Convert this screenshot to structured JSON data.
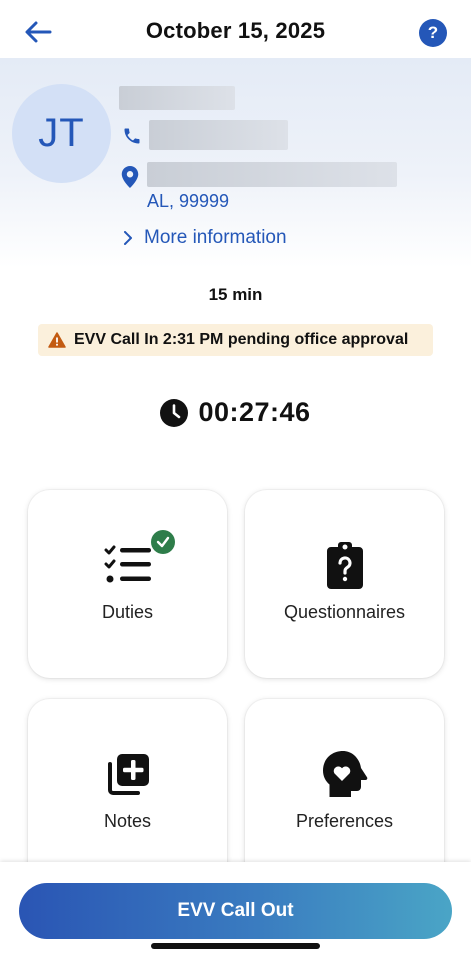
{
  "header": {
    "title": "October 15, 2025",
    "help_label": "?"
  },
  "client": {
    "initials": "JT",
    "address_line": "AL, 99999",
    "more_info_label": "More information"
  },
  "visit": {
    "duration": "15 min",
    "status_banner": "EVV Call In 2:31 PM pending office approval",
    "timer": "00:27:46"
  },
  "tiles": [
    {
      "label": "Duties",
      "icon": "checklist-icon",
      "completed": true
    },
    {
      "label": "Questionnaires",
      "icon": "clipboard-question-icon"
    },
    {
      "label": "Notes",
      "icon": "notes-plus-icon"
    },
    {
      "label": "Preferences",
      "icon": "head-heart-icon"
    }
  ],
  "action": {
    "label": "EVV Call Out"
  },
  "colors": {
    "accent": "#2457b8",
    "success": "#2e7d4a",
    "warning": "#c35b12",
    "banner_bg": "#fbf0dc"
  }
}
